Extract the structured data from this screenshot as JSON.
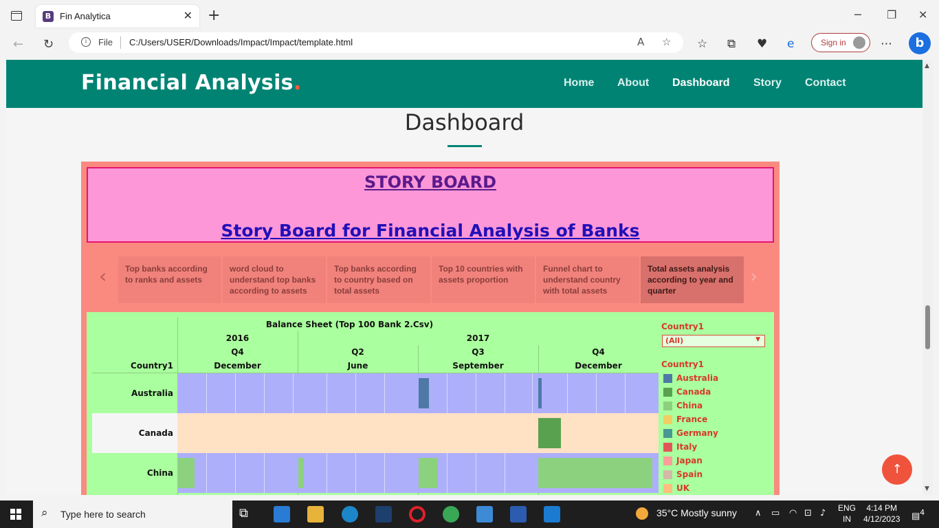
{
  "browser": {
    "tab_title": "Fin Analytica",
    "favicon_letter": "B",
    "address_scheme": "File",
    "address_path": "C:/Users/USER/Downloads/Impact/Impact/template.html",
    "signin_label": "Sign in"
  },
  "site": {
    "logo": "Financial Analysis",
    "logo_dot": ".",
    "nav": [
      "Home",
      "About",
      "Dashboard",
      "Story",
      "Contact"
    ]
  },
  "page": {
    "title": "Dashboard"
  },
  "story": {
    "heading": "STORY BOARD",
    "subheading": "Story Board for Financial Analysis of Banks",
    "points": [
      "Top banks according to ranks and assets",
      "word cloud to understand top banks according to assets",
      "Top banks  according to country based on total assets",
      "Top 10 countries with assets proportion",
      "Funnel chart to understand  country with total assets",
      "Total assets analysis according to year and quarter"
    ],
    "active_index": 5
  },
  "viz": {
    "title": "Balance Sheet (Top 100 Bank 2.Csv)",
    "row_header": "Country1",
    "years": [
      "2016",
      "2017"
    ],
    "quarters": [
      "Q4",
      "Q2",
      "Q3",
      "Q4"
    ],
    "months": [
      "December",
      "June",
      "September",
      "December"
    ],
    "rows": [
      "Australia",
      "Canada",
      "China"
    ],
    "filter_label": "Country1",
    "filter_value": "(All)",
    "legend_title": "Country1",
    "legend": [
      {
        "name": "Australia",
        "color": "#4e79a7"
      },
      {
        "name": "Canada",
        "color": "#59a14f"
      },
      {
        "name": "China",
        "color": "#8cd17d"
      },
      {
        "name": "France",
        "color": "#f1ce63"
      },
      {
        "name": "Germany",
        "color": "#499894"
      },
      {
        "name": "Italy",
        "color": "#e15759"
      },
      {
        "name": "Japan",
        "color": "#ff9d9a"
      },
      {
        "name": "Spain",
        "color": "#d4b9a8"
      },
      {
        "name": "UK",
        "color": "#ffbe7d"
      }
    ]
  },
  "taskbar": {
    "search_placeholder": "Type here to search",
    "weather": "35°C  Mostly sunny",
    "lang_top": "ENG",
    "lang_bottom": "IN",
    "time": "4:14 PM",
    "date": "4/12/2023",
    "notifications": "4"
  }
}
